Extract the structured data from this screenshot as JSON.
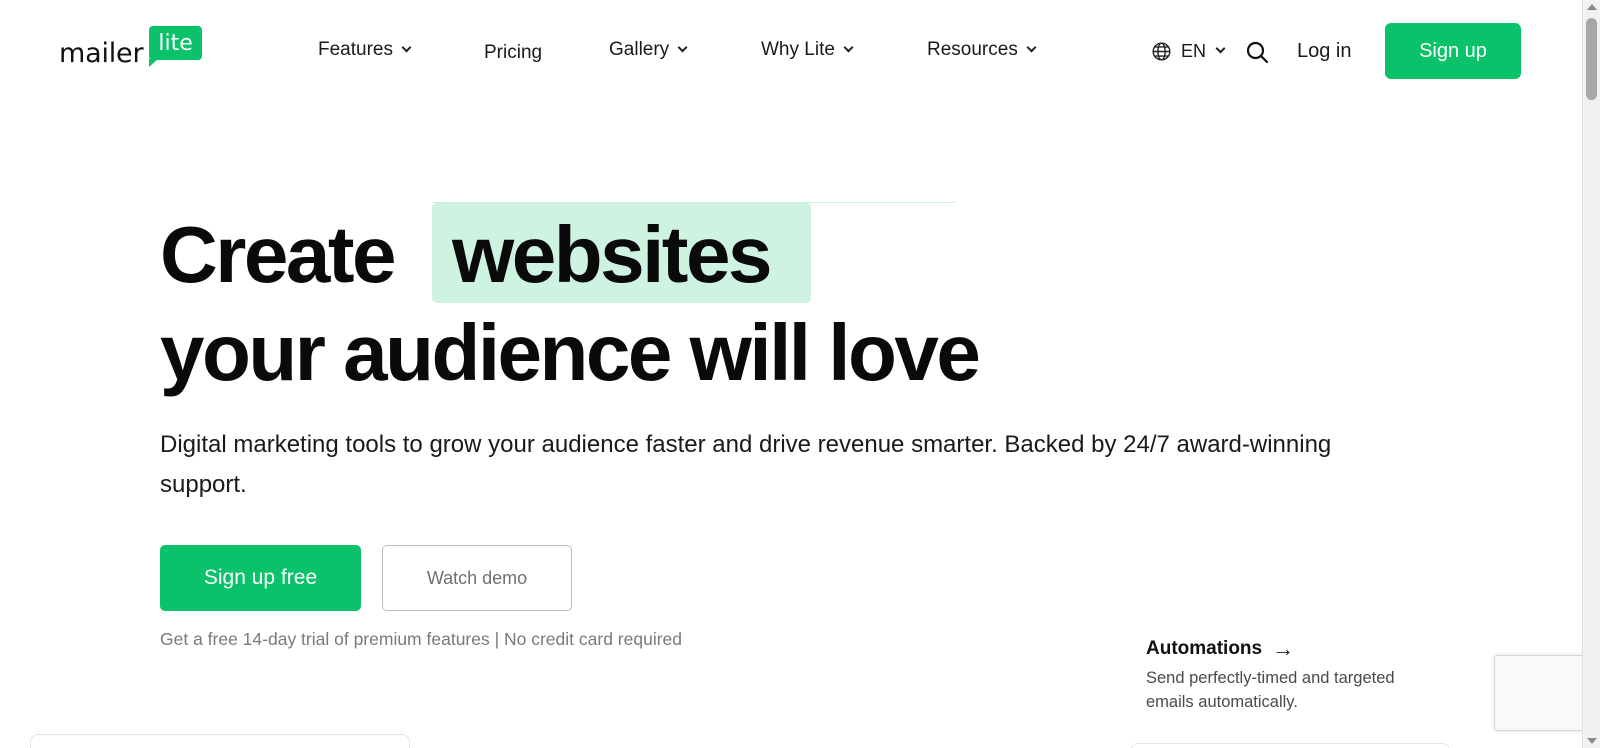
{
  "brand": {
    "name_part1": "mailer",
    "name_part2": "lite",
    "accent_color": "#09c269",
    "highlight_color": "#cef3e0"
  },
  "nav": {
    "features": "Features",
    "pricing": "Pricing",
    "gallery": "Gallery",
    "why_lite": "Why Lite",
    "resources": "Resources"
  },
  "header": {
    "language": "EN",
    "login": "Log in",
    "signup": "Sign up",
    "icons": {
      "language": "globe-icon",
      "search": "search-icon",
      "dropdown": "chevron-down-icon"
    }
  },
  "hero": {
    "title_word1": "Create",
    "title_highlight": "websites",
    "title_line2": "your audience will love",
    "subtitle": "Digital marketing tools to grow your audience faster and drive revenue smarter. Backed by 24/7 award-winning support.",
    "cta_primary": "Sign up free",
    "cta_secondary": "Watch demo",
    "trial_note": "Get a free 14-day trial of premium features | No credit card required"
  },
  "feature_card": {
    "title": "Automations",
    "arrow": "→",
    "description": "Send perfectly-timed and targeted emails automatically."
  }
}
